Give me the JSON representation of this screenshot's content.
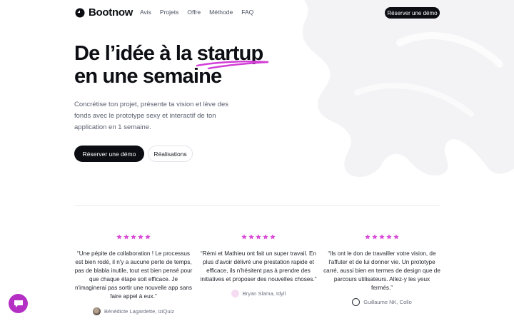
{
  "brand": {
    "name": "Bootnow"
  },
  "nav": {
    "links": [
      "Avis",
      "Projets",
      "Offre",
      "Méthode",
      "FAQ"
    ],
    "cta": "Réserver une démo"
  },
  "hero": {
    "title_line1_prefix": "De l’idée à la ",
    "title_line1_highlight": "startup",
    "title_line2": "en une semaine",
    "subtitle": "Concrétise ton projet, présente ta vision et lève des fonds avec le prototype sexy et interactif de ton application en 1 semaine.",
    "primary_button": "Réserver une démo",
    "secondary_button": "Réalisations"
  },
  "testimonials": [
    {
      "rating": 5,
      "quote": "“Une pépite de collaboration ! Le processus est bien rodé, il n'y a aucune perte de temps, pas de blabla inutile, tout est bien pensé pour que chaque étape soit efficace. Je n'imaginerai pas sortir une nouvelle app sans faire appel à eux.”",
      "author": "Bénédicte Lagardette, iziQuiz"
    },
    {
      "rating": 5,
      "quote": "“Rémi et Mathieu ont fait un super travail. En plus d'avoir délivré une prestation rapide et efficace, ils n'hésitent pas à prendre des initiatives et proposer des nouvelles choses.”",
      "author": "Bryan Slama, Idyll"
    },
    {
      "rating": 5,
      "quote": "“Ils ont le don de travailler votre vision, de l'affuter et de lui donner vie. Un prototype carré, aussi bien en termes de design que de parcours utilisateurs. Allez-y les yeux fermés.”",
      "author": "Guillaume NK, Collo"
    }
  ],
  "icons": {
    "logo": "bootnow-logo-icon",
    "star": "star-icon",
    "chat": "chat-bubble-icon"
  },
  "colors": {
    "accent": "#d23fd6",
    "star": "#d94bd6",
    "dark": "#0b0d12",
    "chat_fab": "#b42fc4",
    "background_shape": "#f3f3f6"
  }
}
